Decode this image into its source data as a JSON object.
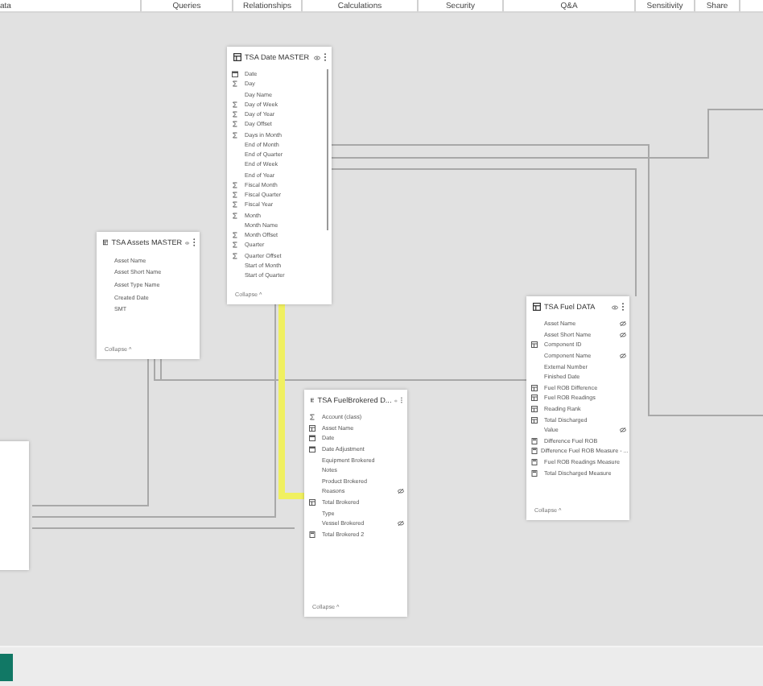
{
  "ribbon": {
    "tabs": [
      {
        "label": "ata"
      },
      {
        "label": "Queries"
      },
      {
        "label": "Relationships"
      },
      {
        "label": "Calculations"
      },
      {
        "label": "Security"
      },
      {
        "label": "Q&A"
      },
      {
        "label": "Sensitivity"
      },
      {
        "label": "Share"
      }
    ]
  },
  "tables": [
    {
      "title": "TSA Date MASTER",
      "scrollable": true,
      "collapse": "Collapse ^",
      "fields": [
        {
          "name": "Date",
          "kind": "date",
          "hidden": false
        },
        {
          "name": "Day",
          "kind": "sum",
          "hidden": false
        },
        {
          "name": "Day Name",
          "kind": "plain",
          "hidden": false
        },
        {
          "name": "Day of Week",
          "kind": "sum",
          "hidden": false
        },
        {
          "name": "Day of Year",
          "kind": "sum",
          "hidden": false
        },
        {
          "name": "Day Offset",
          "kind": "sum",
          "hidden": false
        },
        {
          "name": "Days in Month",
          "kind": "sum",
          "hidden": false
        },
        {
          "name": "End of Month",
          "kind": "plain",
          "hidden": false
        },
        {
          "name": "End of Quarter",
          "kind": "plain",
          "hidden": false
        },
        {
          "name": "End of Week",
          "kind": "plain",
          "hidden": false
        },
        {
          "name": "End of Year",
          "kind": "plain",
          "hidden": false
        },
        {
          "name": "Fiscal Month",
          "kind": "sum",
          "hidden": false
        },
        {
          "name": "Fiscal Quarter",
          "kind": "sum",
          "hidden": false
        },
        {
          "name": "Fiscal Year",
          "kind": "sum",
          "hidden": false
        },
        {
          "name": "Month",
          "kind": "sum",
          "hidden": false
        },
        {
          "name": "Month Name",
          "kind": "plain",
          "hidden": false
        },
        {
          "name": "Month Offset",
          "kind": "sum",
          "hidden": false
        },
        {
          "name": "Quarter",
          "kind": "sum",
          "hidden": false
        },
        {
          "name": "Quarter Offset",
          "kind": "sum",
          "hidden": false
        },
        {
          "name": "Start of Month",
          "kind": "plain",
          "hidden": false
        },
        {
          "name": "Start of Quarter",
          "kind": "plain",
          "hidden": false
        }
      ]
    },
    {
      "title": "TSA Assets MASTER",
      "scrollable": false,
      "collapse": "Collapse ^",
      "fields": [
        {
          "name": "Asset Name",
          "kind": "plain",
          "hidden": false
        },
        {
          "name": "Asset Short Name",
          "kind": "plain",
          "hidden": false
        },
        {
          "name": "Asset Type Name",
          "kind": "plain",
          "hidden": false
        },
        {
          "name": "Created Date",
          "kind": "plain",
          "hidden": false
        },
        {
          "name": "SMT",
          "kind": "plain",
          "hidden": false
        }
      ]
    },
    {
      "title": "TSA Fuel DATA",
      "scrollable": false,
      "collapse": "Collapse ^",
      "fields": [
        {
          "name": "Asset Name",
          "kind": "plain",
          "hidden": true
        },
        {
          "name": "Asset Short Name",
          "kind": "plain",
          "hidden": true
        },
        {
          "name": "Component ID",
          "kind": "column",
          "hidden": false
        },
        {
          "name": "Component Name",
          "kind": "plain",
          "hidden": true
        },
        {
          "name": "External Number",
          "kind": "plain",
          "hidden": false
        },
        {
          "name": "Finished Date",
          "kind": "plain",
          "hidden": false
        },
        {
          "name": "Fuel ROB Difference",
          "kind": "column",
          "hidden": false
        },
        {
          "name": "Fuel ROB Readings",
          "kind": "column",
          "hidden": false
        },
        {
          "name": "Reading Rank",
          "kind": "column",
          "hidden": false
        },
        {
          "name": "Total Discharged",
          "kind": "column",
          "hidden": false
        },
        {
          "name": "Value",
          "kind": "plain",
          "hidden": true
        },
        {
          "name": "Difference Fuel ROB",
          "kind": "measure",
          "hidden": false
        },
        {
          "name": "Difference Fuel ROB Measure - ...",
          "kind": "measure",
          "hidden": false
        },
        {
          "name": "Fuel ROB Readings Measure",
          "kind": "measure",
          "hidden": false
        },
        {
          "name": "Total Discharged Measure",
          "kind": "measure",
          "hidden": false
        }
      ]
    },
    {
      "title": "TSA FuelBrokered D...",
      "scrollable": false,
      "collapse": "Collapse ^",
      "fields": [
        {
          "name": "Account (class)",
          "kind": "sum",
          "hidden": false
        },
        {
          "name": "Asset Name",
          "kind": "column",
          "hidden": false
        },
        {
          "name": "Date",
          "kind": "date",
          "hidden": false
        },
        {
          "name": "Date Adjustment",
          "kind": "date",
          "hidden": false
        },
        {
          "name": "Equipment Brokered",
          "kind": "plain",
          "hidden": false
        },
        {
          "name": "Notes",
          "kind": "plain",
          "hidden": false
        },
        {
          "name": "Product Brokered",
          "kind": "plain",
          "hidden": false
        },
        {
          "name": "Reasons",
          "kind": "plain",
          "hidden": true
        },
        {
          "name": "Total Brokered",
          "kind": "column",
          "hidden": false
        },
        {
          "name": "Type",
          "kind": "plain",
          "hidden": false
        },
        {
          "name": "Vessel Brokered",
          "kind": "plain",
          "hidden": true
        },
        {
          "name": "Total Brokered 2",
          "kind": "measure",
          "hidden": false
        }
      ]
    }
  ],
  "relationships": [
    {
      "selected": false
    },
    {
      "selected": false
    },
    {
      "selected": false
    },
    {
      "selected": false
    },
    {
      "selected": false
    },
    {
      "selected": false
    },
    {
      "selected": false
    },
    {
      "selected": true
    }
  ]
}
